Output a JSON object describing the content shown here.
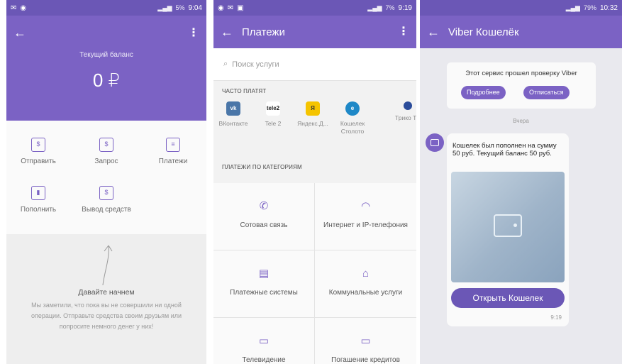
{
  "screen1": {
    "status_time": "9:04",
    "status_battery": "5%",
    "balance_label": "Текущий баланс",
    "balance_value": "0 ₽",
    "actions": [
      {
        "label": "Отправить",
        "icon": "send-money-icon",
        "glyph": "$"
      },
      {
        "label": "Запрос",
        "icon": "request-money-icon",
        "glyph": "$"
      },
      {
        "label": "Платежи",
        "icon": "payments-icon",
        "glyph": "≡"
      },
      {
        "label": "Пополнить",
        "icon": "top-up-icon",
        "glyph": "▮"
      },
      {
        "label": "Вывод средств",
        "icon": "withdraw-icon",
        "glyph": "$"
      }
    ],
    "empty_title": "Давайте начнем",
    "empty_text": "Мы заметили, что пока вы не совершили ни одной операции. Отправьте средства своим друзьям или попросите немного денег у них!"
  },
  "screen2": {
    "status_time": "9:19",
    "status_battery": "7%",
    "title": "Платежи",
    "search_placeholder": "Поиск услуги",
    "frequent_label": "ЧАСТО ПЛАТЯТ",
    "frequent": [
      {
        "label": "ВКонтакте",
        "logo": "vk",
        "color": "#4a76a8"
      },
      {
        "label": "Tele 2",
        "logo": "tele2",
        "color": "#1f1f1f"
      },
      {
        "label": "Яндекс.Д...",
        "logo": "yandex",
        "color": "#f5c400"
      },
      {
        "label": "Кошелек Столото",
        "logo": "stoloto",
        "color": "#1e88c7"
      },
      {
        "label": "Трико ТВ",
        "logo": "trikolor",
        "color": "#2b4c9a"
      }
    ],
    "categories_label": "ПЛАТЕЖИ ПО КАТЕГОРИЯМ",
    "categories": [
      {
        "label": "Сотовая связь",
        "icon": "phone-icon",
        "glyph": "✆"
      },
      {
        "label": "Интернет и IP-телефония",
        "icon": "wifi-icon",
        "glyph": "◠"
      },
      {
        "label": "Платежные системы",
        "icon": "payment-systems-icon",
        "glyph": "▤"
      },
      {
        "label": "Коммунальные услуги",
        "icon": "bank-icon",
        "glyph": "⌂"
      },
      {
        "label": "Телевидение",
        "icon": "tv-icon",
        "glyph": "▭"
      },
      {
        "label": "Погашение кредитов",
        "icon": "card-icon",
        "glyph": "▭"
      }
    ]
  },
  "screen3": {
    "status_time": "10:32",
    "status_battery": "79%",
    "title": "Viber Кошелёк",
    "verify_text": "Этот сервис прошел проверку Viber",
    "more_button": "Подробнее",
    "unsubscribe_button": "Отписаться",
    "date_label": "Вчера",
    "message_text": "Кошелек был пополнен на сумму 50 руб. Текущий баланс 50 руб.",
    "open_button": "Открыть Кошелек",
    "message_time": "9:19"
  },
  "colors": {
    "accent": "#7b62c4",
    "status_bar": "#6b57b6"
  }
}
